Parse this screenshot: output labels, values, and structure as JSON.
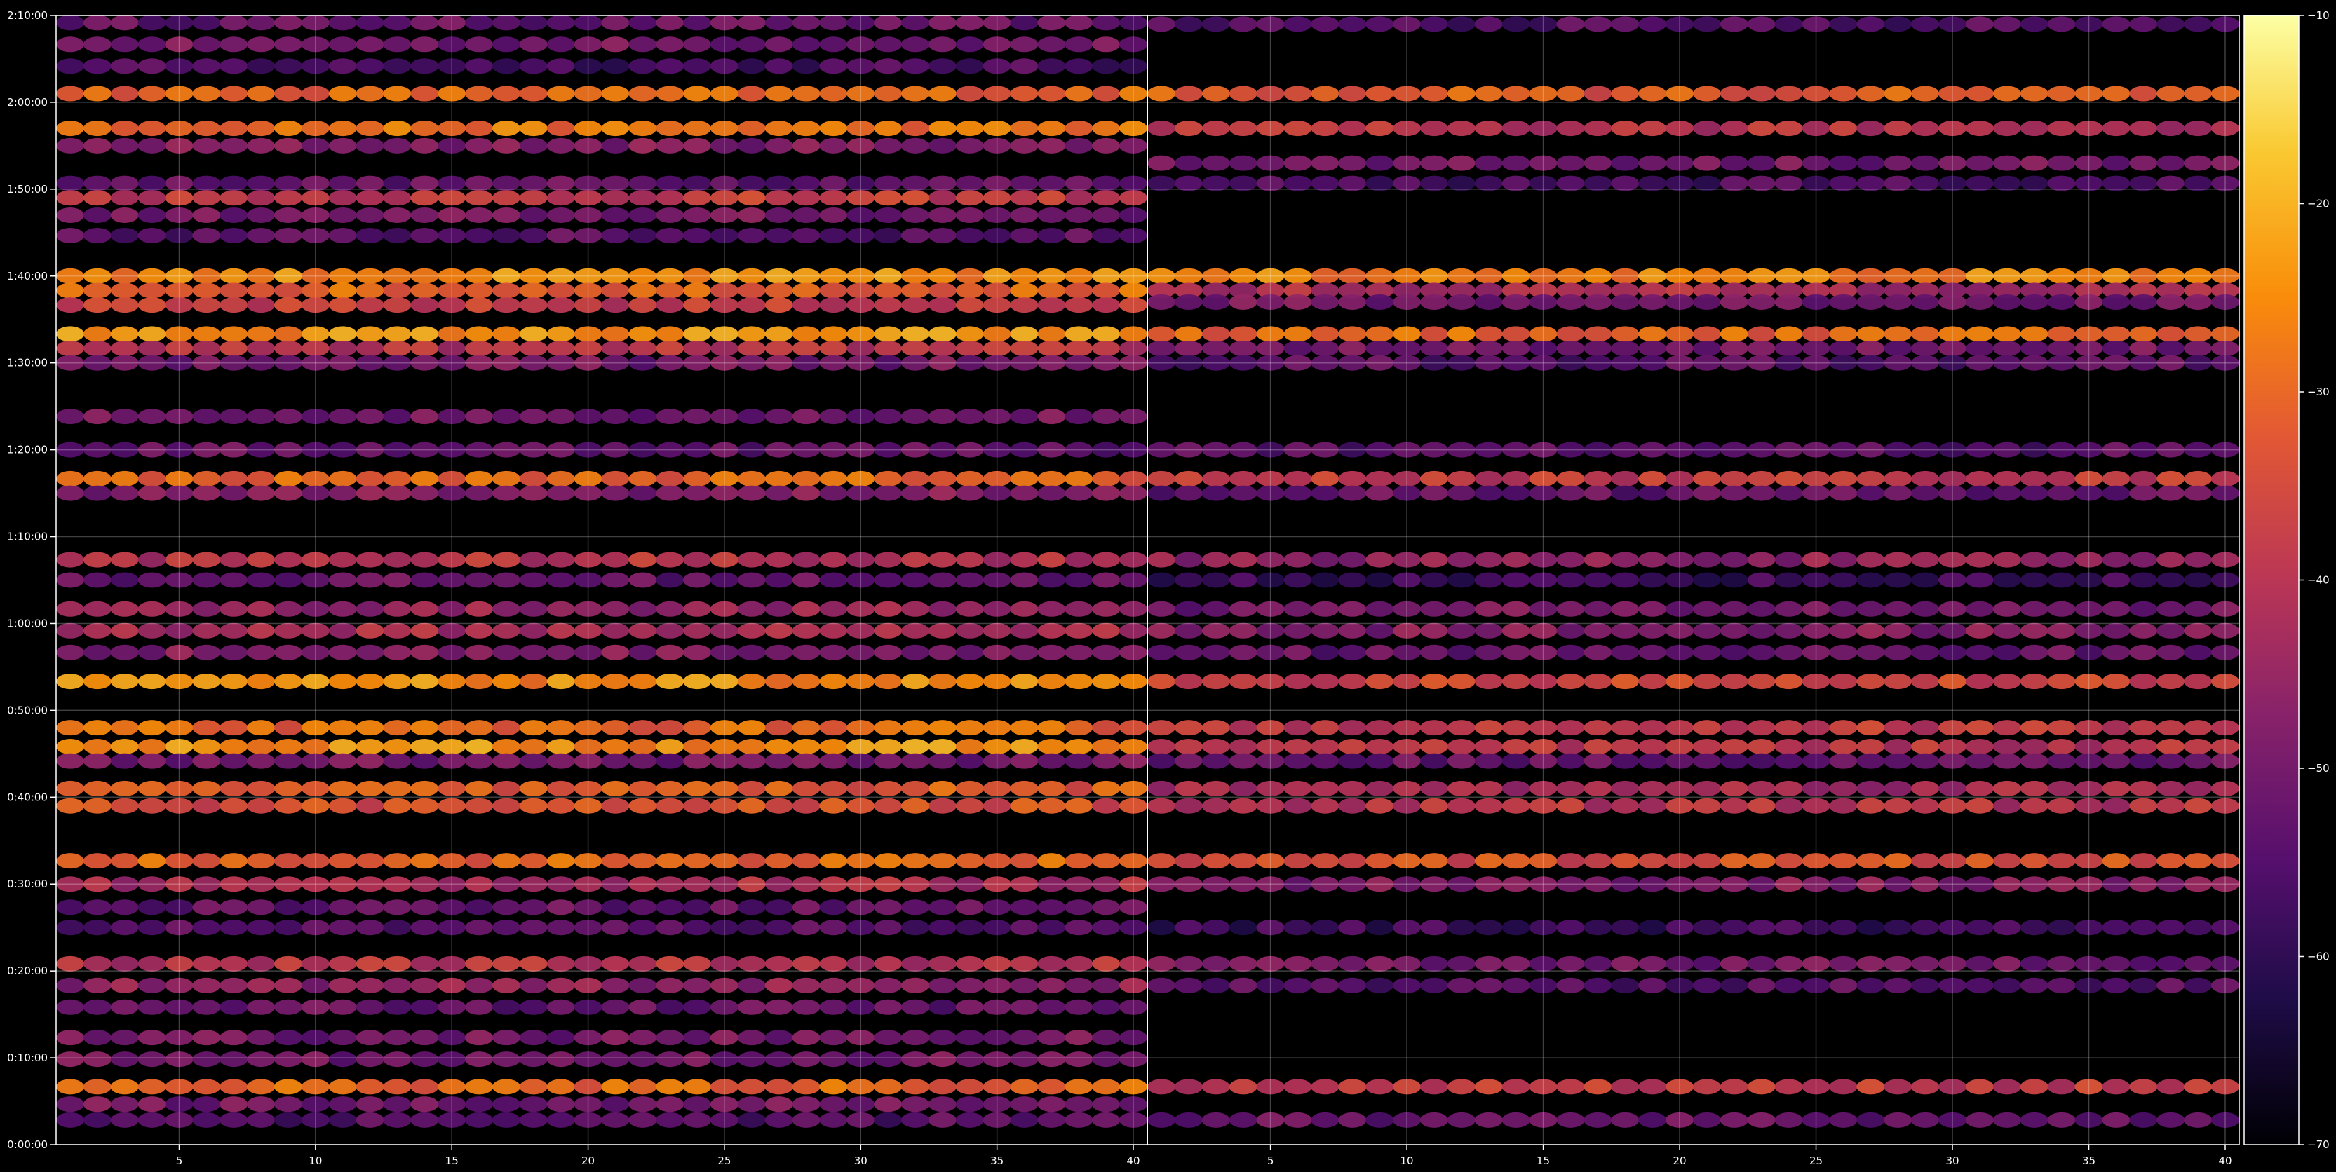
{
  "chart_data": {
    "type": "heatmap",
    "title": "",
    "xlabel": "",
    "ylabel": "",
    "panels": [
      {
        "name": "",
        "x_range": [
          1,
          40
        ],
        "x_ticks": [
          5,
          10,
          15,
          20,
          25,
          30,
          35,
          40
        ],
        "x_tick_labels": [
          "5",
          "10",
          "15",
          "20",
          "25",
          "30",
          "35",
          "40"
        ],
        "bands": [
          {
            "t": 7750,
            "level": -52
          },
          {
            "t": 7600,
            "level": -50
          },
          {
            "t": 7450,
            "level": -56
          },
          {
            "t": 7260,
            "level": -30
          },
          {
            "t": 7020,
            "level": -28
          },
          {
            "t": 6900,
            "level": -48
          },
          {
            "t": 6640,
            "level": -52
          },
          {
            "t": 6540,
            "level": -38
          },
          {
            "t": 6420,
            "level": -50
          },
          {
            "t": 6280,
            "level": -54
          },
          {
            "t": 6000,
            "level": -25
          },
          {
            "t": 5900,
            "level": -30
          },
          {
            "t": 5800,
            "level": -38
          },
          {
            "t": 5600,
            "level": -24
          },
          {
            "t": 5500,
            "level": -40
          },
          {
            "t": 5400,
            "level": -50
          },
          {
            "t": 5030,
            "level": -50
          },
          {
            "t": 4800,
            "level": -52
          },
          {
            "t": 4600,
            "level": -30
          },
          {
            "t": 4500,
            "level": -48
          },
          {
            "t": 4040,
            "level": -40
          },
          {
            "t": 3900,
            "level": -52
          },
          {
            "t": 3700,
            "level": -45
          },
          {
            "t": 3550,
            "level": -42
          },
          {
            "t": 3400,
            "level": -48
          },
          {
            "t": 3200,
            "level": -25
          },
          {
            "t": 2880,
            "level": -30
          },
          {
            "t": 2750,
            "level": -24
          },
          {
            "t": 2650,
            "level": -50
          },
          {
            "t": 2460,
            "level": -32
          },
          {
            "t": 2340,
            "level": -34
          },
          {
            "t": 1960,
            "level": -30
          },
          {
            "t": 1800,
            "level": -42
          },
          {
            "t": 1640,
            "level": -52
          },
          {
            "t": 1500,
            "level": -54
          },
          {
            "t": 1250,
            "level": -40
          },
          {
            "t": 1100,
            "level": -46
          },
          {
            "t": 950,
            "level": -52
          },
          {
            "t": 740,
            "level": -50
          },
          {
            "t": 590,
            "level": -50
          },
          {
            "t": 400,
            "level": -30
          },
          {
            "t": 280,
            "level": -50
          },
          {
            "t": 170,
            "level": -54
          }
        ]
      },
      {
        "name": "",
        "x_range": [
          1,
          40
        ],
        "x_ticks": [
          5,
          10,
          15,
          20,
          25,
          30,
          35,
          40
        ],
        "x_tick_labels": [
          "5",
          "10",
          "15",
          "20",
          "25",
          "30",
          "35",
          "40"
        ],
        "bands": [
          {
            "t": 7740,
            "level": -55
          },
          {
            "t": 7260,
            "level": -32
          },
          {
            "t": 7020,
            "level": -40
          },
          {
            "t": 6780,
            "level": -50
          },
          {
            "t": 6640,
            "level": -56
          },
          {
            "t": 6000,
            "level": -26
          },
          {
            "t": 5900,
            "level": -42
          },
          {
            "t": 5820,
            "level": -50
          },
          {
            "t": 5600,
            "level": -30
          },
          {
            "t": 5500,
            "level": -50
          },
          {
            "t": 5400,
            "level": -54
          },
          {
            "t": 4800,
            "level": -54
          },
          {
            "t": 4600,
            "level": -38
          },
          {
            "t": 4500,
            "level": -52
          },
          {
            "t": 4040,
            "level": -46
          },
          {
            "t": 3900,
            "level": -58
          },
          {
            "t": 3700,
            "level": -50
          },
          {
            "t": 3550,
            "level": -48
          },
          {
            "t": 3400,
            "level": -52
          },
          {
            "t": 3200,
            "level": -36
          },
          {
            "t": 2880,
            "level": -38
          },
          {
            "t": 2750,
            "level": -40
          },
          {
            "t": 2650,
            "level": -52
          },
          {
            "t": 2460,
            "level": -42
          },
          {
            "t": 2340,
            "level": -40
          },
          {
            "t": 1960,
            "level": -34
          },
          {
            "t": 1800,
            "level": -48
          },
          {
            "t": 1500,
            "level": -58
          },
          {
            "t": 1250,
            "level": -50
          },
          {
            "t": 1100,
            "level": -54
          },
          {
            "t": 400,
            "level": -38
          },
          {
            "t": 170,
            "level": -52
          }
        ]
      }
    ],
    "y_range": [
      0,
      7800
    ],
    "y_ticks": [
      0,
      600,
      1200,
      1800,
      2400,
      3000,
      3600,
      4200,
      4800,
      5400,
      6000,
      6600,
      7200,
      7800
    ],
    "y_tick_labels": [
      "0:00:00",
      "0:10:00",
      "0:20:00",
      "0:30:00",
      "0:40:00",
      "0:50:00",
      "1:00:00",
      "1:10:00",
      "1:20:00",
      "1:30:00",
      "1:40:00",
      "1:50:00",
      "2:00:00",
      "2:10:00"
    ],
    "colorbar": {
      "colormap": "inferno",
      "range": [
        -70,
        -10
      ],
      "ticks": [
        -10,
        -20,
        -30,
        -40,
        -50,
        -60,
        -70
      ],
      "tick_labels": [
        "−10",
        "−20",
        "−30",
        "−40",
        "−50",
        "−60",
        "−70"
      ]
    },
    "grid": true,
    "background": "#000000",
    "foreground": "#ffffff"
  }
}
